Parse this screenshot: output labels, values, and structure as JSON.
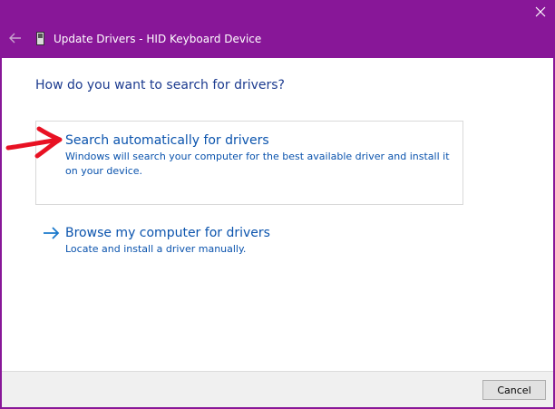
{
  "window": {
    "title": "Update Drivers - HID Keyboard Device",
    "accent_color": "#881798",
    "icons": [
      "back-arrow-icon",
      "device-icon",
      "close-icon"
    ]
  },
  "main": {
    "heading": "How do you want to search for drivers?",
    "options": [
      {
        "title": "Search automatically for drivers",
        "description": "Windows will search your computer for the best available driver and install it on your device.",
        "icon": "arrow-right-icon"
      },
      {
        "title": "Browse my computer for drivers",
        "description": "Locate and install a driver manually.",
        "icon": "arrow-right-icon"
      }
    ],
    "annotation": {
      "icon": "red-arrow-annotation",
      "color": "#e81123"
    }
  },
  "footer": {
    "cancel_label": "Cancel"
  },
  "colors": {
    "link_blue": "#0a53ad",
    "heading_blue": "#1c3b8f"
  }
}
